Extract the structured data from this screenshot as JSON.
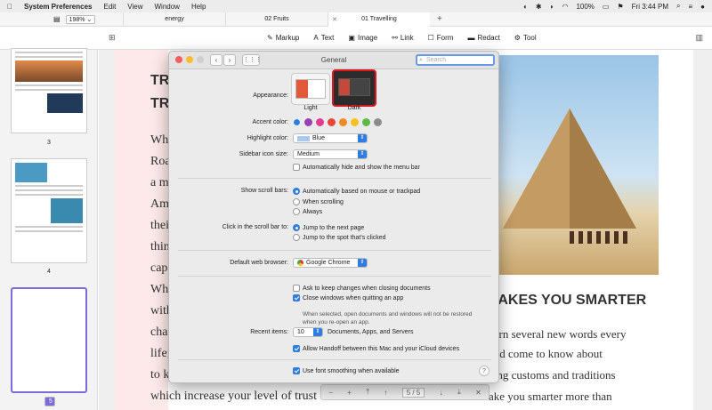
{
  "menubar": {
    "apple": "",
    "app": "System Preferences",
    "items": [
      "Edit",
      "View",
      "Window",
      "Help"
    ],
    "battery": "100%",
    "clock": "Fri 3:44 PM"
  },
  "tabbar": {
    "zoom": "198%",
    "tabs": [
      {
        "label": "energy"
      },
      {
        "label": "02 Fruits"
      },
      {
        "label": "01 Travelling"
      }
    ],
    "add": "+"
  },
  "toolbar": {
    "markup": "Markup",
    "text": "Text",
    "image": "Image",
    "link": "Link",
    "form": "Form",
    "redact": "Redact",
    "tool": "Tool"
  },
  "sidebar": {
    "pages": [
      "3",
      "4",
      "5"
    ]
  },
  "document": {
    "title_lines": [
      "TR",
      "TR"
    ],
    "left_lines": [
      "Wha",
      "Roa",
      "a m",
      "Am",
      "thei",
      "thin",
      "cap",
      "Whi",
      "with",
      "cha",
      "life;",
      "to k",
      "which increase your level of trust"
    ],
    "right_heading": "MAKES YOU SMARTER",
    "right_lines": [
      "earn several new words every",
      "and come to know about",
      "zing customs and traditions",
      "ake you smarter more than"
    ]
  },
  "viewer": {
    "page_current": "5",
    "page_sep": "/",
    "page_total": "5"
  },
  "dialog": {
    "title": "General",
    "search_placeholder": "Search",
    "appearance_label": "Appearance:",
    "appearance_light": "Light",
    "appearance_dark": "Dark",
    "accent_label": "Accent color:",
    "accent_colors": [
      "#2f7de1",
      "#9b3fb5",
      "#e23b8f",
      "#e9453a",
      "#f08a24",
      "#f5c21b",
      "#5cb946",
      "#8c8c8c"
    ],
    "highlight_label": "Highlight color:",
    "highlight_value": "Blue",
    "sidebar_label": "Sidebar icon size:",
    "sidebar_value": "Medium",
    "autohide": "Automatically hide and show the menu bar",
    "scroll_label": "Show scroll bars:",
    "scroll_opts": [
      "Automatically based on mouse or trackpad",
      "When scrolling",
      "Always"
    ],
    "click_label": "Click in the scroll bar to:",
    "click_opts": [
      "Jump to the next page",
      "Jump to the spot that's clicked"
    ],
    "browser_label": "Default web browser:",
    "browser_value": "Google Chrome",
    "ask_keep": "Ask to keep changes when closing documents",
    "close_windows": "Close windows when quitting an app",
    "close_note": "When selected, open documents and windows will not be restored when you re-open an app.",
    "recent_label": "Recent items:",
    "recent_value": "10",
    "recent_suffix": "Documents, Apps, and Servers",
    "handoff": "Allow Handoff between this Mac and your iCloud devices",
    "font_smoothing": "Use font smoothing when available",
    "help": "?"
  }
}
